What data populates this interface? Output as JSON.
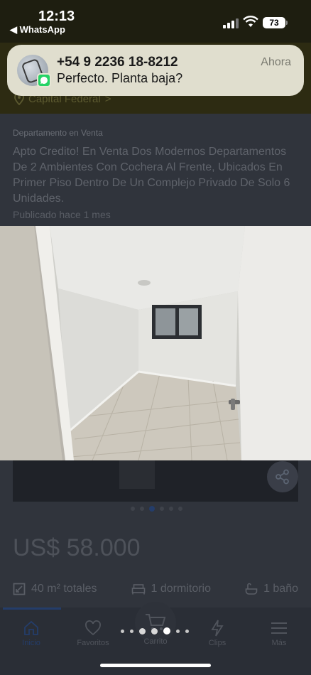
{
  "status_bar": {
    "time": "12:13",
    "back_app": "◀ WhatsApp",
    "battery": "73"
  },
  "notification": {
    "sender": "+54 9 2236 18-8212",
    "message": "Perfecto.  Planta baja?",
    "time": "Ahora",
    "app_icon": "whatsapp-icon"
  },
  "header": {
    "location": "Capital Federal"
  },
  "listing": {
    "category": "Departamento en Venta",
    "title": "Apto Credito! En Venta Dos Modernos Departamentos De 2 Ambientes Con Cochera Al Frente, Ubicados En Primer Piso Dentro De Un Complejo Privado De Solo 6 Unidades.",
    "published": "Publicado hace 1 mes",
    "price": "US$ 58.000",
    "features": {
      "area": "40 m² totales",
      "bedrooms": "1 dormitorio",
      "bathrooms": "1 baño"
    }
  },
  "nav": {
    "home": "Inicio",
    "favorites": "Favoritos",
    "cart": "Carrito",
    "clips": "Clips",
    "more": "Más"
  },
  "colors": {
    "accent": "#243d6a",
    "whatsapp": "#25d366"
  }
}
